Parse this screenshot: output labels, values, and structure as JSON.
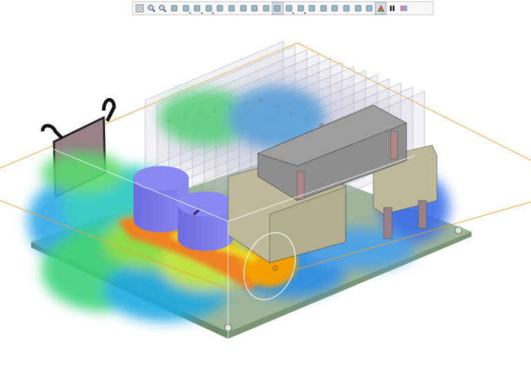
{
  "toolbar": {
    "buttons": [
      {
        "name": "zoom-to-fit",
        "icon": "zoom-fit-icon"
      },
      {
        "name": "zoom-in",
        "icon": "zoom-in-icon"
      },
      {
        "name": "zoom-out",
        "icon": "zoom-out-icon"
      },
      {
        "name": "zoom-to-area",
        "icon": "zoom-area-icon"
      },
      {
        "name": "rotate-view",
        "icon": "rotate-icon"
      },
      {
        "name": "view-orientation",
        "icon": "view-cube-icon"
      },
      {
        "name": "display-style",
        "icon": "display-style-icon"
      },
      {
        "name": "section-view",
        "icon": "section-icon"
      },
      {
        "name": "component-view",
        "icon": "component-icon"
      },
      {
        "name": "view-front",
        "icon": "box-view-icon"
      },
      {
        "name": "view-rotate",
        "icon": "box-rotate-icon"
      },
      {
        "name": "view-isometric",
        "icon": "iso-view-icon"
      },
      {
        "name": "cut-plot",
        "icon": "cut-plot-icon",
        "active": true
      },
      {
        "name": "surface-plot",
        "icon": "surface-plot-icon"
      },
      {
        "name": "isosurface",
        "icon": "isosurface-icon"
      },
      {
        "name": "point-params",
        "icon": "point-params-icon"
      },
      {
        "name": "surface-params",
        "icon": "surface-params-icon"
      },
      {
        "name": "volume-params",
        "icon": "volume-params-icon"
      },
      {
        "name": "xy-plot",
        "icon": "xy-plot-icon"
      },
      {
        "name": "goals",
        "icon": "goals-icon"
      },
      {
        "name": "particle-study",
        "icon": "particle-icon"
      },
      {
        "name": "flow-trajectories",
        "icon": "flow-trajectories-icon",
        "active": true
      },
      {
        "name": "pause-animation",
        "icon": "pause-icon"
      },
      {
        "name": "legend",
        "icon": "legend-icon"
      }
    ]
  },
  "colors": {
    "accent_active": "#d5dbe3",
    "board": "#8fa58a",
    "capacitor": "#7a78e6",
    "transformer_core": "#8e8e8e",
    "transformer_coil": "#bdb99a",
    "domain_outline": "#f0a030"
  }
}
